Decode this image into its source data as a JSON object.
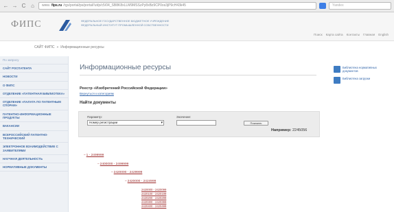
{
  "browser": {
    "back": "←",
    "forward": "→",
    "reload": "C",
    "home": "⌂",
    "url_prefix": "www.",
    "url_domain": "fips.ru",
    "url_rest": "/rgs/portal/ps/portal/!ut/p/c5/04_SB8K8xLLM9MSSzPy8xBz9CP0os3jP9cH43k45",
    "search_placeholder": "Yandex"
  },
  "header": {
    "logo": "ФИПС",
    "org_line1": "ФЕДЕРАЛЬНОЕ ГОСУДАРСТВЕННОЕ БЮДЖЕТНОЕ УЧРЕЖДЕНИЕ",
    "org_line2": "ФЕДЕРАЛЬНЫЙ ИНСТИТУТ ПРОМЫШЛЕННОЙ СОБСТВЕННОСТИ",
    "links": [
      "Поиск",
      "Карта сайта",
      "Контакты",
      "Главная",
      "English"
    ]
  },
  "breadcrumb": {
    "home": "САЙТ ФИПС",
    "sep": "»",
    "current": "Информационные ресурсы"
  },
  "sidebar": {
    "search_label": "По запросу",
    "items": [
      "Сайт Роспатента",
      "Новости",
      "О ФИПС",
      "Отделение «Патентная библиотека»",
      "Отделение «Палата по патентным спорам»",
      "Патентно-информационные продукты",
      "Вакансии",
      "Всероссийский патентно-технический",
      "Электронное взаимодействие с заявителями",
      "Научная деятельность",
      "Нормативные документы"
    ]
  },
  "main": {
    "title": "Информационные ресурсы",
    "registry_title": "Реестр «Изобретений Российской Федерации»",
    "back_link": "Вернуться к категориям",
    "find_title": "Найти документы",
    "param_label": "Параметр:",
    "param_value": "Номер регистрации",
    "value_label": "Значение:",
    "value_input": "",
    "find_button": "Показать",
    "example_label": "Например:",
    "example_value": "2245056"
  },
  "tree": {
    "level1": "1 - 2499999",
    "level2": "2400000 - 2499999",
    "level3": "2420000 - 2429999",
    "level4": "2420000 - 2424999",
    "leaves": [
      "2420000 - 2420099",
      "2420100 - 2420199",
      "2420200 - 2420299",
      "2420300 - 2420399",
      "2420400 - 2420499"
    ]
  },
  "right": {
    "links": [
      "Библиотека нормативных документов",
      "Библиотека загрузки"
    ]
  },
  "colors": {
    "link": "#3366aa",
    "tree_link": "#9c2b2b",
    "sidebar_bg": "#eef1f5"
  }
}
